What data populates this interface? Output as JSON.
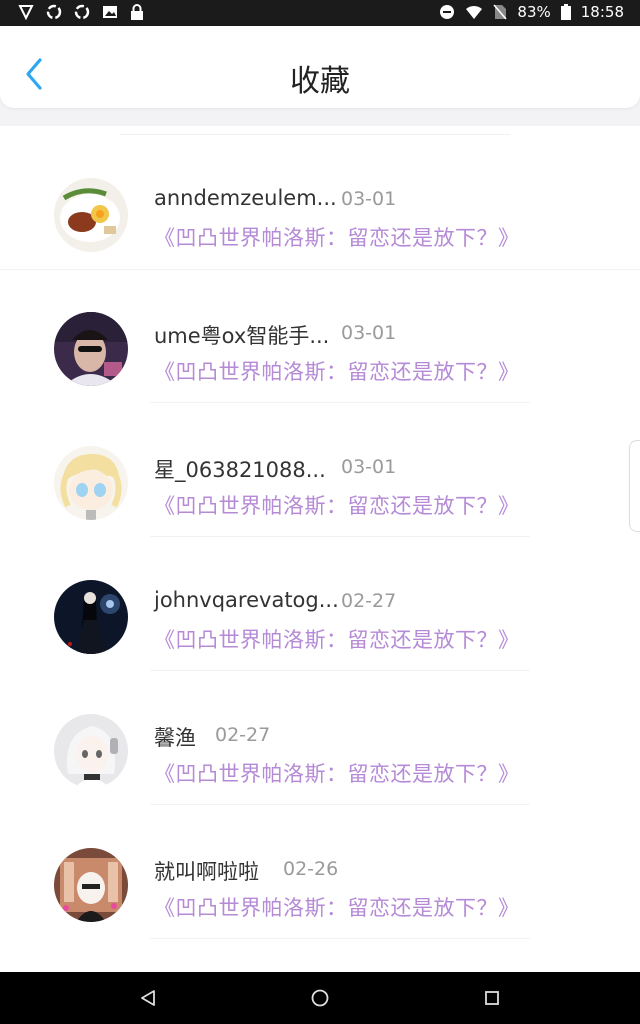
{
  "status_bar": {
    "battery": "83%",
    "time": "18:58"
  },
  "header": {
    "title": "收藏"
  },
  "items": [
    {
      "name": "anndemzeulem...",
      "date": "03-01",
      "article": "《凹凸世界帕洛斯：留恋还是放下？》"
    },
    {
      "name": "ume粤ox智能手...",
      "date": "03-01",
      "article": "《凹凸世界帕洛斯：留恋还是放下？》"
    },
    {
      "name": "星_063821088...",
      "date": "03-01",
      "article": "《凹凸世界帕洛斯：留恋还是放下？》"
    },
    {
      "name": "johnvqarevatog...",
      "date": "02-27",
      "article": "《凹凸世界帕洛斯：留恋还是放下？》"
    },
    {
      "name": "馨渔",
      "date": "02-27",
      "article": "《凹凸世界帕洛斯：留恋还是放下？》"
    },
    {
      "name": "就叫啊啦啦",
      "date": "02-26",
      "article": "《凹凸世界帕洛斯：留恋还是放下？》"
    }
  ],
  "colors": {
    "accent": "#2ea7f0",
    "article_text": "#b58ad6"
  }
}
